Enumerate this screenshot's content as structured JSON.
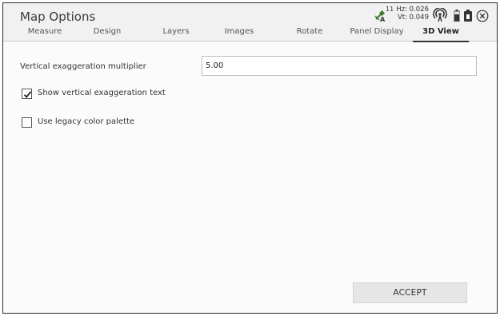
{
  "window": {
    "title": "Map Options"
  },
  "tabs": [
    {
      "label": "Measure",
      "active": false
    },
    {
      "label": "Design",
      "active": false
    },
    {
      "label": "Layers",
      "active": false
    },
    {
      "label": "Images",
      "active": false
    },
    {
      "label": "Rotate",
      "active": false
    },
    {
      "label": "Panel Display",
      "active": false
    },
    {
      "label": "3D View",
      "active": true
    }
  ],
  "status": {
    "satellite_icon": "satellite-icon",
    "satellite_count": "11",
    "hz": "Hz: 0.026",
    "vt": "Vt: 0.049",
    "antenna_icon": "antenna-icon",
    "battery_icon": "battery-icon",
    "close_icon": "close-icon"
  },
  "form": {
    "vertical_exaggeration_label": "Vertical exaggeration multiplier",
    "vertical_exaggeration_value": "5.00",
    "show_text_label": "Show vertical exaggeration text",
    "show_text_checked": true,
    "legacy_palette_label": "Use legacy color palette",
    "legacy_palette_checked": false
  },
  "actions": {
    "accept_label": "ACCEPT"
  },
  "colors": {
    "header_bg": "#f1f1f1",
    "accent": "#333333",
    "button_bg": "#e6e6e6"
  }
}
